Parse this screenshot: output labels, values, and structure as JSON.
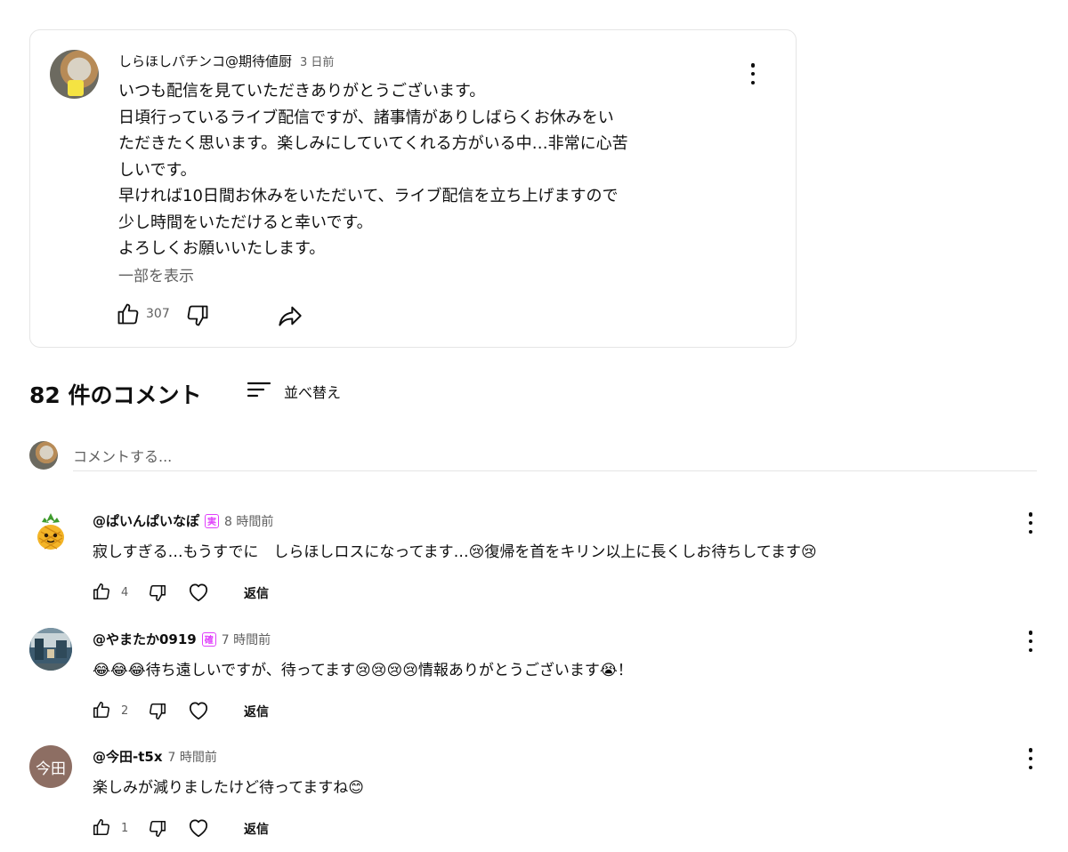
{
  "post": {
    "author": "しらほしパチンコ@期待値厨",
    "time": "3 日前",
    "lines": [
      "いつも配信を見ていただきありがとうございます。",
      "日頃行っているライブ配信ですが、諸事情がありしばらくお休みをい",
      "ただきたく思います。楽しみにしていてくれる方がいる中…非常に心苦",
      "しいです。",
      "早ければ10日間お休みをいただいて、ライブ配信を立ち上げますので",
      "少し時間をいただけると幸いです。",
      "よろしくお願いいたします。"
    ],
    "show_more": "一部を表示",
    "like_count": "307"
  },
  "comments_header": {
    "count_label": "82 件のコメント",
    "sort_label": "並べ替え"
  },
  "add_comment": {
    "placeholder": "コメントする..."
  },
  "comments": [
    {
      "author": "@ぱいんぱいなぽ",
      "badge": "実",
      "time": "8 時間前",
      "text": "寂しすぎる…もうすでに　しらほしロスになってます…😢復帰を首をキリン以上に長くしお待ちしてます😢",
      "likes": "4",
      "reply": "返信"
    },
    {
      "author": "@やまたか0919",
      "badge": "確",
      "time": "7 時間前",
      "text": "😂😂😂待ち遠しいですが、待ってます😢😢😢😢情報ありがとうございます😭！",
      "likes": "2",
      "reply": "返信"
    },
    {
      "author": "@今田-t5x",
      "time": "7 時間前",
      "avatar_text": "今田",
      "text": "楽しみが減りましたけど待ってますね😊",
      "likes": "1",
      "reply": "返信"
    }
  ],
  "colors": {
    "secondary_text": "#606060",
    "badge": "#e040fb",
    "avatar_brown": "#8d6e63",
    "border": "#e5e5e5"
  }
}
